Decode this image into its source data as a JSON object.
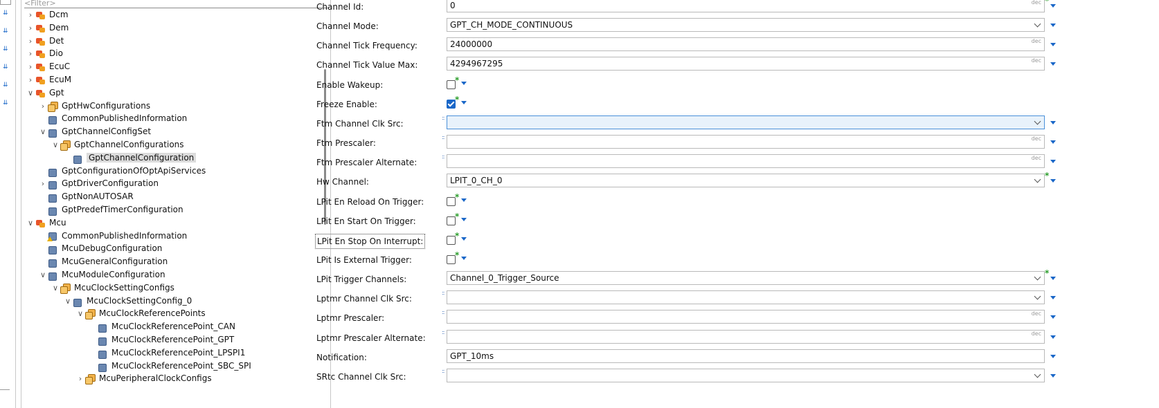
{
  "tree": {
    "filter_placeholder": "<Filter>",
    "nodes": [
      {
        "label": "Dcm",
        "toggle": ">",
        "icon": "module"
      },
      {
        "label": "Dem",
        "toggle": ">",
        "icon": "module"
      },
      {
        "label": "Det",
        "toggle": ">",
        "icon": "module"
      },
      {
        "label": "Dio",
        "toggle": ">",
        "icon": "module"
      },
      {
        "label": "EcuC",
        "toggle": ">",
        "icon": "module"
      },
      {
        "label": "EcuM",
        "toggle": ">",
        "icon": "module"
      },
      {
        "label": "Gpt",
        "toggle": "v",
        "icon": "module"
      },
      {
        "label": "GptHwConfigurations",
        "toggle": ">",
        "icon": "list"
      },
      {
        "label": "CommonPublishedInformation",
        "toggle": "",
        "icon": "container"
      },
      {
        "label": "GptChannelConfigSet",
        "toggle": "v",
        "icon": "container"
      },
      {
        "label": "GptChannelConfigurations",
        "toggle": "v",
        "icon": "list"
      },
      {
        "label": "GptChannelConfiguration",
        "toggle": "",
        "icon": "container",
        "selected": true
      },
      {
        "label": "GptConfigurationOfOptApiServices",
        "toggle": "",
        "icon": "container"
      },
      {
        "label": "GptDriverConfiguration",
        "toggle": ">",
        "icon": "container"
      },
      {
        "label": "GptNonAUTOSAR",
        "toggle": "",
        "icon": "container"
      },
      {
        "label": "GptPredefTimerConfiguration",
        "toggle": "",
        "icon": "container"
      },
      {
        "label": "Mcu",
        "toggle": "v",
        "icon": "module"
      },
      {
        "label": "CommonPublishedInformation",
        "toggle": "",
        "icon": "warning"
      },
      {
        "label": "McuDebugConfiguration",
        "toggle": "",
        "icon": "container"
      },
      {
        "label": "McuGeneralConfiguration",
        "toggle": "",
        "icon": "container"
      },
      {
        "label": "McuModuleConfiguration",
        "toggle": "v",
        "icon": "container"
      },
      {
        "label": "McuClockSettingConfigs",
        "toggle": "v",
        "icon": "list"
      },
      {
        "label": "McuClockSettingConfig_0",
        "toggle": "v",
        "icon": "container"
      },
      {
        "label": "McuClockReferencePoints",
        "toggle": "v",
        "icon": "list"
      },
      {
        "label": "McuClockReferencePoint_CAN",
        "toggle": "",
        "icon": "container"
      },
      {
        "label": "McuClockReferencePoint_GPT",
        "toggle": "",
        "icon": "container"
      },
      {
        "label": "McuClockReferencePoint_LPSPI1",
        "toggle": "",
        "icon": "container"
      },
      {
        "label": "McuClockReferencePoint_SBC_SPI",
        "toggle": "",
        "icon": "container"
      },
      {
        "label": "McuPeripheralClockConfigs",
        "toggle": ">",
        "icon": "list"
      }
    ]
  },
  "form": {
    "unit": "dec",
    "rows": [
      {
        "label": "Channel Id:",
        "kind": "text",
        "value": "0",
        "dec": true,
        "star": true
      },
      {
        "label": "Channel Mode:",
        "kind": "select",
        "value": "GPT_CH_MODE_CONTINUOUS"
      },
      {
        "label": "Channel Tick Frequency:",
        "kind": "text",
        "value": "24000000",
        "dec": true
      },
      {
        "label": "Channel Tick Value Max:",
        "kind": "text",
        "value": "4294967295",
        "dec": true
      },
      {
        "label": "Enable Wakeup:",
        "kind": "checkbox",
        "checked": false
      },
      {
        "label": "Freeze Enable:",
        "kind": "checkbox",
        "checked": true
      },
      {
        "label": "Ftm Channel Clk Src:",
        "kind": "select",
        "value": "",
        "active": true,
        "marker": true
      },
      {
        "label": "Ftm Prescaler:",
        "kind": "text",
        "value": "",
        "dec": true,
        "marker": true
      },
      {
        "label": "Ftm Prescaler  Alternate:",
        "kind": "text",
        "value": "",
        "dec": true,
        "marker": true
      },
      {
        "label": "Hw Channel:",
        "kind": "select",
        "value": "LPIT_0_CH_0",
        "star": true
      },
      {
        "label": "LPit En Reload On Trigger:",
        "kind": "checkbox",
        "checked": false
      },
      {
        "label": "LPit En Start On Trigger:",
        "kind": "checkbox",
        "checked": false
      },
      {
        "label": "LPit En Stop On Interrupt:",
        "kind": "checkbox",
        "checked": false,
        "focus": true
      },
      {
        "label": "LPit Is External Trigger:",
        "kind": "checkbox",
        "checked": false
      },
      {
        "label": "LPit Trigger Channels:",
        "kind": "select",
        "value": "Channel_0_Trigger_Source",
        "star": true
      },
      {
        "label": "Lptmr Channel Clk Src:",
        "kind": "select",
        "value": "",
        "marker": true
      },
      {
        "label": "Lptmr Prescaler:",
        "kind": "text",
        "value": "",
        "dec": true,
        "marker": true
      },
      {
        "label": "Lptmr Prescaler  Alternate:",
        "kind": "text",
        "value": "",
        "dec": true,
        "marker": true
      },
      {
        "label": "Notification:",
        "kind": "text",
        "value": "GPT_10ms"
      },
      {
        "label": "SRtc Channel Clk Src:",
        "kind": "select",
        "value": "",
        "marker": true
      }
    ]
  }
}
